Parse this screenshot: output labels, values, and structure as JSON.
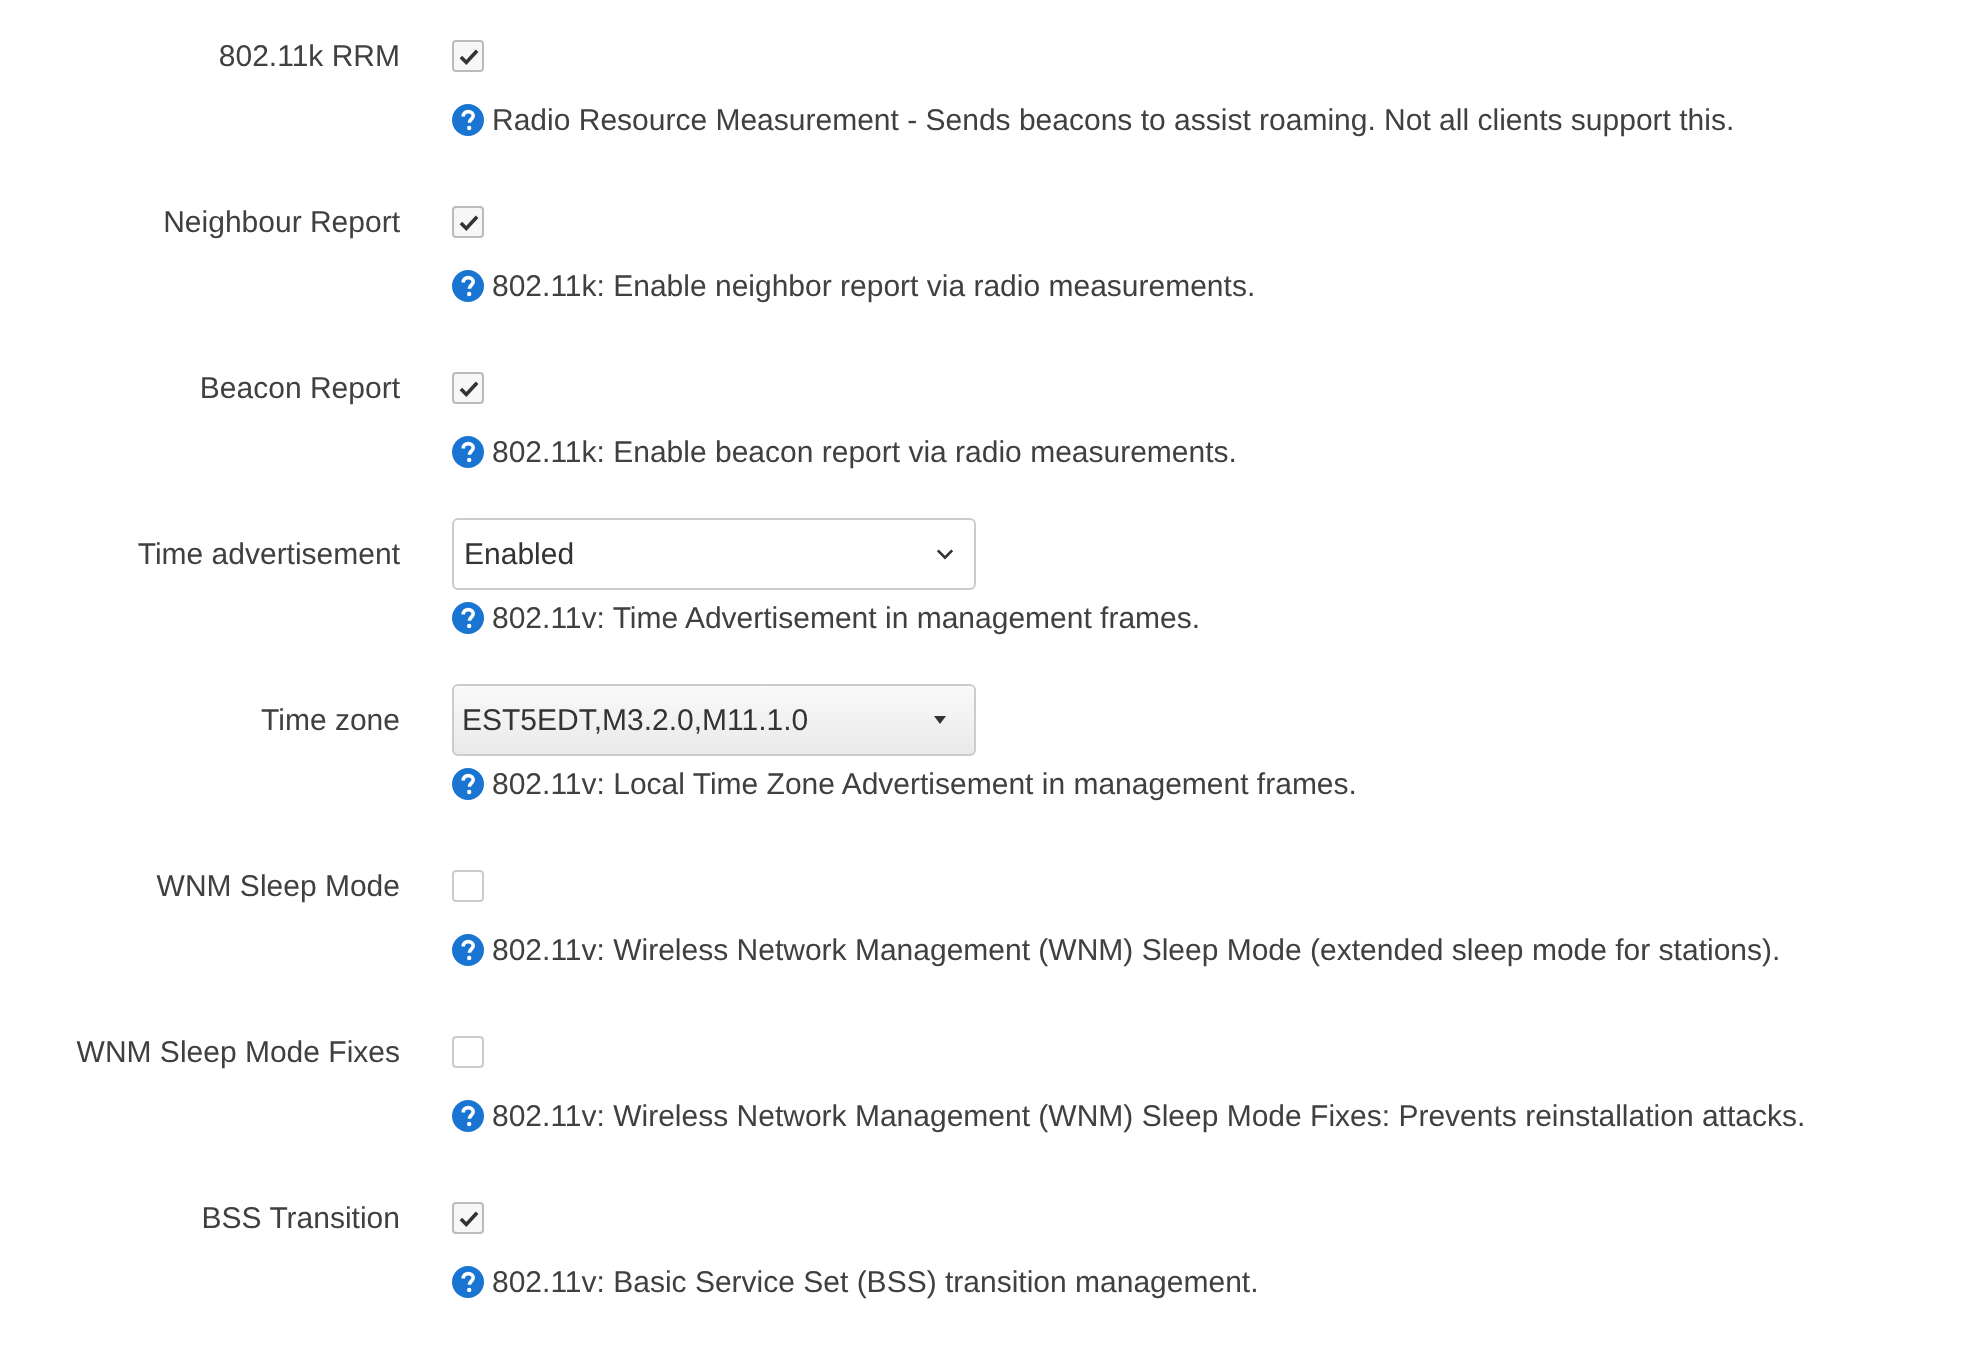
{
  "settings": [
    {
      "label": "802.11k RRM",
      "kind": "checkbox",
      "checked": true,
      "help": "Radio Resource Measurement - Sends beacons to assist roaming. Not all clients support this."
    },
    {
      "label": "Neighbour Report",
      "kind": "checkbox",
      "checked": true,
      "help": "802.11k: Enable neighbor report via radio measurements."
    },
    {
      "label": "Beacon Report",
      "kind": "checkbox",
      "checked": true,
      "help": "802.11k: Enable beacon report via radio measurements."
    },
    {
      "label": "Time advertisement",
      "kind": "select",
      "value": "Enabled",
      "help": "802.11v: Time Advertisement in management frames."
    },
    {
      "label": "Time zone",
      "kind": "dropdown",
      "value": "EST5EDT,M3.2.0,M11.1.0",
      "help": "802.11v: Local Time Zone Advertisement in management frames."
    },
    {
      "label": "WNM Sleep Mode",
      "kind": "checkbox",
      "checked": false,
      "help": "802.11v: Wireless Network Management (WNM) Sleep Mode (extended sleep mode for stations)."
    },
    {
      "label": "WNM Sleep Mode Fixes",
      "kind": "checkbox",
      "checked": false,
      "help": "802.11v: Wireless Network Management (WNM) Sleep Mode Fixes: Prevents reinstallation attacks."
    },
    {
      "label": "BSS Transition",
      "kind": "checkbox",
      "checked": true,
      "help": "802.11v: Basic Service Set (BSS) transition management."
    }
  ]
}
